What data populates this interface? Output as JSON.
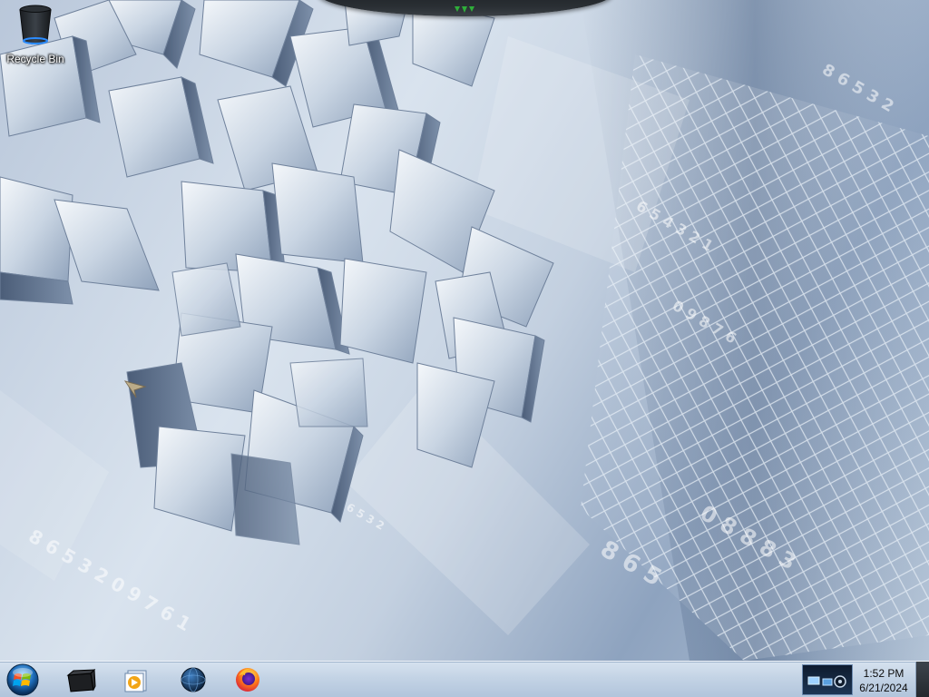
{
  "desktop": {
    "icons": [
      {
        "name": "recycle-bin",
        "label": "Recycle Bin"
      }
    ]
  },
  "top_dock": {
    "indicator_color": "#2fae3a"
  },
  "taskbar": {
    "pinned": [
      {
        "name": "file-explorer",
        "icon": "dark-folder-icon"
      },
      {
        "name": "media-player",
        "icon": "media-player-icon"
      },
      {
        "name": "globe-app",
        "icon": "globe-icon"
      },
      {
        "name": "firefox",
        "icon": "firefox-icon"
      }
    ],
    "clock": {
      "time": "1:52 PM",
      "date": "6/21/2024"
    }
  },
  "colors": {
    "taskbar_top": "#d6e2ef",
    "taskbar_bottom": "#b1c4db",
    "wallpaper_base": "#c3d0e0",
    "accent_blue": "#1e5fa8"
  }
}
